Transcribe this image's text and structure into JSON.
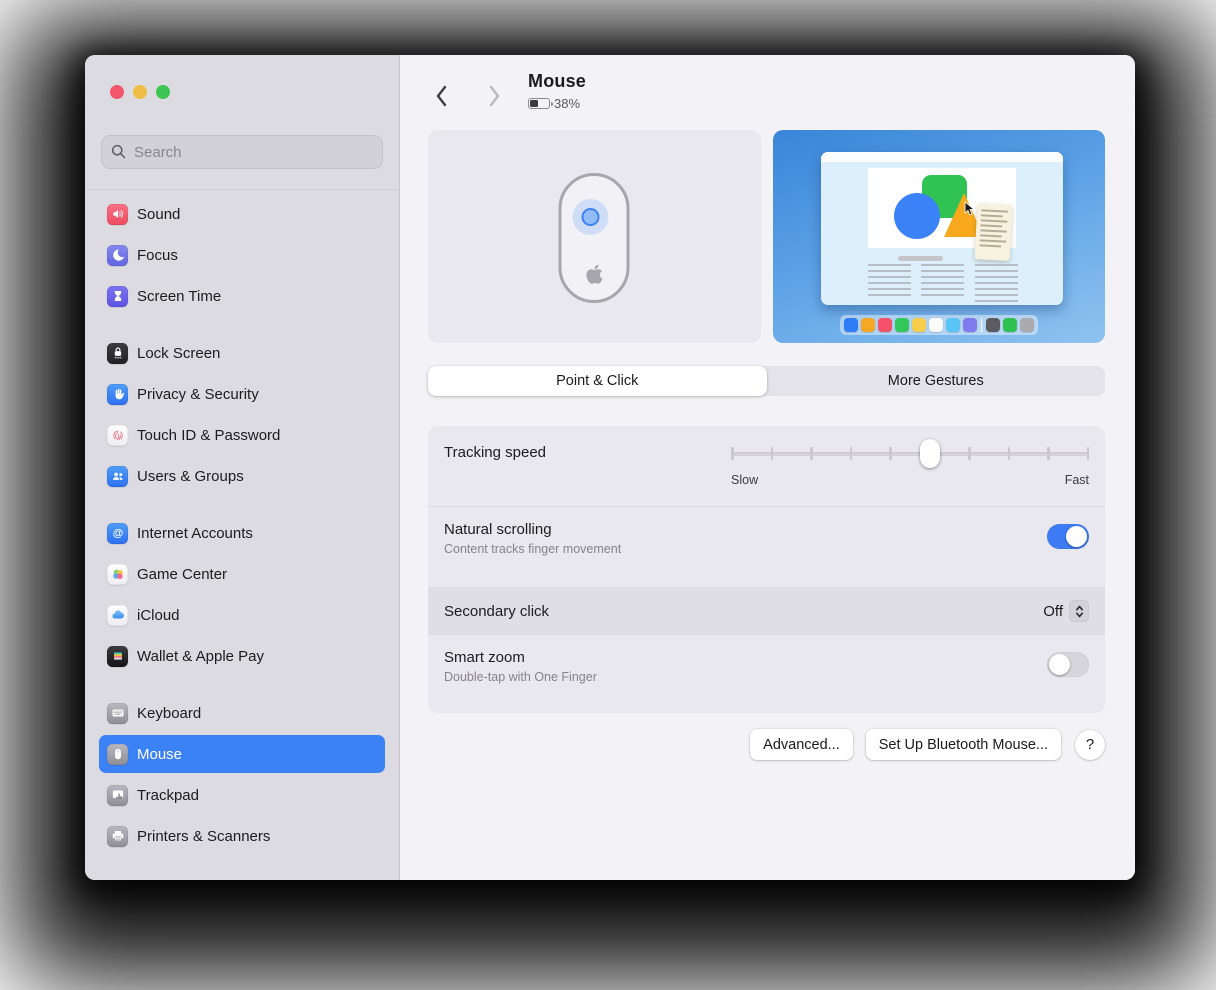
{
  "colors": {
    "accent": "#3b82f7",
    "toggle_on": "#3d7cf5",
    "traffic": [
      "#f4566d",
      "#f0bd45",
      "#3bc552"
    ],
    "sidebar_bg": "#dcdbe1",
    "main_bg": "#f3f2f7",
    "card_bg": "#e9e8ee",
    "secondary_row_bg": "#dfdee4"
  },
  "sidebar": {
    "search_placeholder": "Search",
    "groups": [
      {
        "items": [
          {
            "label": "Sound",
            "icon": "speaker-icon",
            "bg": [
              "#fb7185",
              "#ec4d5f"
            ]
          },
          {
            "label": "Focus",
            "icon": "moon-icon",
            "bg": [
              "#8589ef",
              "#6065e2"
            ]
          },
          {
            "label": "Screen Time",
            "icon": "hourglass-icon",
            "bg": [
              "#7b74f0",
              "#5c53e4"
            ]
          }
        ]
      },
      {
        "items": [
          {
            "label": "Lock Screen",
            "icon": "lock-icon",
            "bg": [
              "#3c3c41",
              "#202024"
            ]
          },
          {
            "label": "Privacy & Security",
            "icon": "hand-icon",
            "bg": [
              "#4f9df8",
              "#2e70f1"
            ]
          },
          {
            "label": "Touch ID & Password",
            "icon": "fingerprint-icon",
            "bg": [
              "#ffffff",
              "#eeedf2"
            ]
          },
          {
            "label": "Users & Groups",
            "icon": "users-icon",
            "bg": [
              "#4f9df8",
              "#2e70f1"
            ]
          }
        ]
      },
      {
        "items": [
          {
            "label": "Internet Accounts",
            "icon": "at-icon",
            "bg": [
              "#4f9df8",
              "#2e70f1"
            ]
          },
          {
            "label": "Game Center",
            "icon": "game-center-icon",
            "bg": [
              "#ffffff",
              "#eeedf2"
            ]
          },
          {
            "label": "iCloud",
            "icon": "cloud-icon",
            "bg": [
              "#ffffff",
              "#eeedf2"
            ]
          },
          {
            "label": "Wallet & Apple Pay",
            "icon": "wallet-icon",
            "bg": [
              "#3c3c41",
              "#141417"
            ]
          }
        ]
      },
      {
        "items": [
          {
            "label": "Keyboard",
            "icon": "keyboard-icon",
            "bg": [
              "#b9b8c0",
              "#8f8e96"
            ]
          },
          {
            "label": "Mouse",
            "icon": "mouse-icon",
            "bg": [
              "#b9b8c0",
              "#8f8e96"
            ],
            "selected": true
          },
          {
            "label": "Trackpad",
            "icon": "trackpad-icon",
            "bg": [
              "#b9b8c0",
              "#8f8e96"
            ]
          },
          {
            "label": "Printers & Scanners",
            "icon": "printer-icon",
            "bg": [
              "#b9b8c0",
              "#8f8e96"
            ]
          }
        ]
      }
    ]
  },
  "header": {
    "title": "Mouse",
    "battery_percent": "38%"
  },
  "preview": {
    "shape_circle": "#3b82f6",
    "shape_square": "#30c353",
    "shape_triangle": "#f7a81c",
    "dock_colors": [
      "#2e7cf6",
      "#f7a823",
      "#f4516b",
      "#32c759",
      "#f6ce4c",
      "#fafafa",
      "#59c5f7",
      "#8179ee",
      "#5b5b60",
      "#2fc150",
      "#ababaf"
    ],
    "dock_separator_after": 8
  },
  "tabs": [
    {
      "label": "Point & Click",
      "selected": true
    },
    {
      "label": "More Gestures",
      "selected": false
    }
  ],
  "settings": {
    "tracking_speed": {
      "label": "Tracking speed",
      "min_label": "Slow",
      "max_label": "Fast",
      "ticks": 10,
      "value_percent": 55.5
    },
    "natural_scrolling": {
      "label": "Natural scrolling",
      "description": "Content tracks finger movement",
      "enabled": true
    },
    "secondary_click": {
      "label": "Secondary click",
      "value": "Off"
    },
    "smart_zoom": {
      "label": "Smart zoom",
      "description": "Double-tap with One Finger",
      "enabled": false
    }
  },
  "footer": {
    "advanced_label": "Advanced...",
    "setup_label": "Set Up Bluetooth Mouse...",
    "help_label": "?"
  }
}
